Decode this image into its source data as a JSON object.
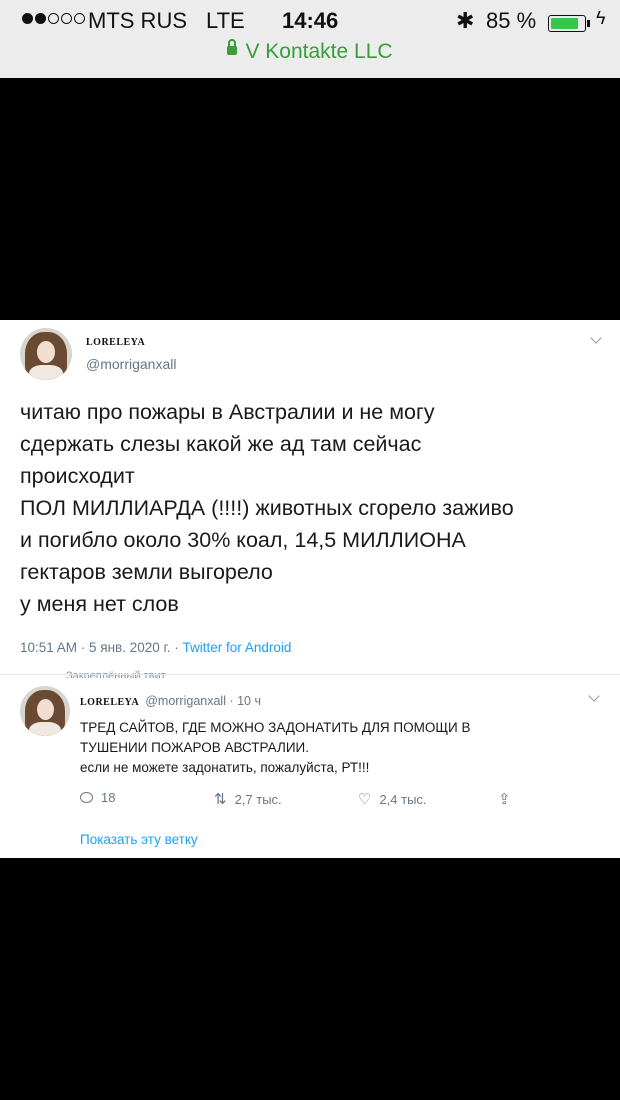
{
  "status_bar": {
    "carrier": "MTS RUS",
    "network": "LTE",
    "time": "14:46",
    "battery_percent": "85 %",
    "battery_level": 0.85,
    "site": "V Kontakte LLC",
    "signal_bars": 2,
    "icons": [
      "signal-icon",
      "bluetooth-icon",
      "battery-icon",
      "charging-icon",
      "lock-icon"
    ]
  },
  "tweet": {
    "author_name": "LORELEYA",
    "handle": "@morriganxall",
    "text_lines": [
      "читаю про пожары в Австралии и не могу",
      "сдержать слезы какой же ад там сейчас",
      "происходит",
      "ПОЛ МИЛЛИАРДА (!!!!) животных сгорело заживо",
      "и погибло около 30% коал, 14,5 МИЛЛИОНА",
      "гектаров земли выгорело",
      "у меня нет слов"
    ],
    "meta_time": "10:51 AM · 5 янв. 2020 г. · ",
    "meta_source": "Twitter for Android",
    "pinned_label": "Закреплённый твит"
  },
  "reply": {
    "author_name": "LORELEYA",
    "handle_time": "@morriganxall · 10 ч",
    "text_lines": [
      "ТРЕД САЙТОВ, ГДЕ МОЖНО ЗАДОНАТИТЬ ДЛЯ ПОМОЩИ В",
      "ТУШЕНИИ ПОЖАРОВ АВСТРАЛИИ.",
      "если не можете задонатить, пожалуйста, РТ!!!"
    ],
    "replies": "18",
    "retweets": "2,7 тыс.",
    "likes": "2,4 тыс.",
    "show_thread": "Показать эту ветку"
  },
  "colors": {
    "link": "#1da1f2",
    "url_green": "#3a9d3a",
    "battery_green": "#35c74a",
    "muted": "#657786"
  }
}
